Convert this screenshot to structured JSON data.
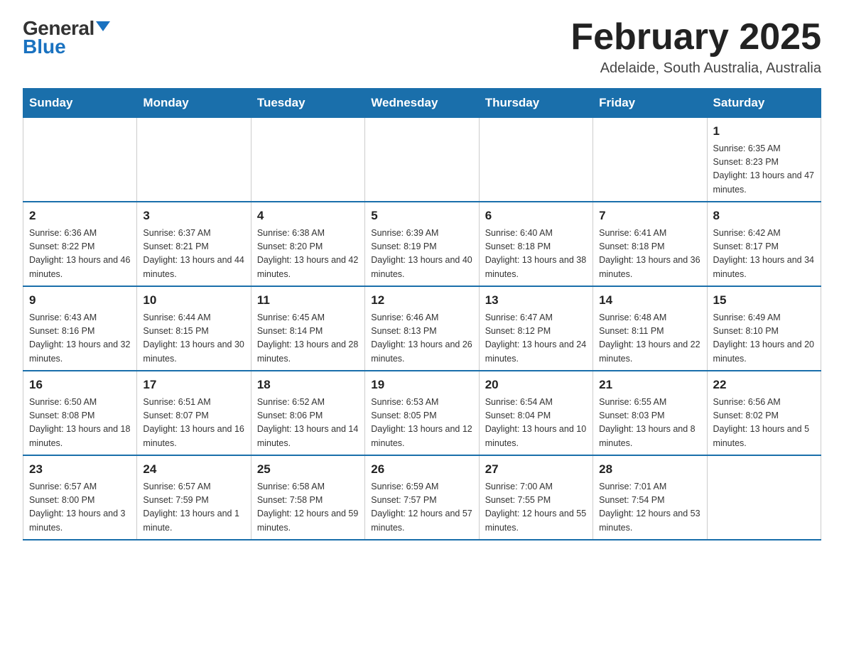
{
  "logo": {
    "general": "General",
    "blue": "Blue",
    "triangle": "▾"
  },
  "title": "February 2025",
  "subtitle": "Adelaide, South Australia, Australia",
  "headers": [
    "Sunday",
    "Monday",
    "Tuesday",
    "Wednesday",
    "Thursday",
    "Friday",
    "Saturday"
  ],
  "weeks": [
    [
      {
        "day": "",
        "info": ""
      },
      {
        "day": "",
        "info": ""
      },
      {
        "day": "",
        "info": ""
      },
      {
        "day": "",
        "info": ""
      },
      {
        "day": "",
        "info": ""
      },
      {
        "day": "",
        "info": ""
      },
      {
        "day": "1",
        "info": "Sunrise: 6:35 AM\nSunset: 8:23 PM\nDaylight: 13 hours and 47 minutes."
      }
    ],
    [
      {
        "day": "2",
        "info": "Sunrise: 6:36 AM\nSunset: 8:22 PM\nDaylight: 13 hours and 46 minutes."
      },
      {
        "day": "3",
        "info": "Sunrise: 6:37 AM\nSunset: 8:21 PM\nDaylight: 13 hours and 44 minutes."
      },
      {
        "day": "4",
        "info": "Sunrise: 6:38 AM\nSunset: 8:20 PM\nDaylight: 13 hours and 42 minutes."
      },
      {
        "day": "5",
        "info": "Sunrise: 6:39 AM\nSunset: 8:19 PM\nDaylight: 13 hours and 40 minutes."
      },
      {
        "day": "6",
        "info": "Sunrise: 6:40 AM\nSunset: 8:18 PM\nDaylight: 13 hours and 38 minutes."
      },
      {
        "day": "7",
        "info": "Sunrise: 6:41 AM\nSunset: 8:18 PM\nDaylight: 13 hours and 36 minutes."
      },
      {
        "day": "8",
        "info": "Sunrise: 6:42 AM\nSunset: 8:17 PM\nDaylight: 13 hours and 34 minutes."
      }
    ],
    [
      {
        "day": "9",
        "info": "Sunrise: 6:43 AM\nSunset: 8:16 PM\nDaylight: 13 hours and 32 minutes."
      },
      {
        "day": "10",
        "info": "Sunrise: 6:44 AM\nSunset: 8:15 PM\nDaylight: 13 hours and 30 minutes."
      },
      {
        "day": "11",
        "info": "Sunrise: 6:45 AM\nSunset: 8:14 PM\nDaylight: 13 hours and 28 minutes."
      },
      {
        "day": "12",
        "info": "Sunrise: 6:46 AM\nSunset: 8:13 PM\nDaylight: 13 hours and 26 minutes."
      },
      {
        "day": "13",
        "info": "Sunrise: 6:47 AM\nSunset: 8:12 PM\nDaylight: 13 hours and 24 minutes."
      },
      {
        "day": "14",
        "info": "Sunrise: 6:48 AM\nSunset: 8:11 PM\nDaylight: 13 hours and 22 minutes."
      },
      {
        "day": "15",
        "info": "Sunrise: 6:49 AM\nSunset: 8:10 PM\nDaylight: 13 hours and 20 minutes."
      }
    ],
    [
      {
        "day": "16",
        "info": "Sunrise: 6:50 AM\nSunset: 8:08 PM\nDaylight: 13 hours and 18 minutes."
      },
      {
        "day": "17",
        "info": "Sunrise: 6:51 AM\nSunset: 8:07 PM\nDaylight: 13 hours and 16 minutes."
      },
      {
        "day": "18",
        "info": "Sunrise: 6:52 AM\nSunset: 8:06 PM\nDaylight: 13 hours and 14 minutes."
      },
      {
        "day": "19",
        "info": "Sunrise: 6:53 AM\nSunset: 8:05 PM\nDaylight: 13 hours and 12 minutes."
      },
      {
        "day": "20",
        "info": "Sunrise: 6:54 AM\nSunset: 8:04 PM\nDaylight: 13 hours and 10 minutes."
      },
      {
        "day": "21",
        "info": "Sunrise: 6:55 AM\nSunset: 8:03 PM\nDaylight: 13 hours and 8 minutes."
      },
      {
        "day": "22",
        "info": "Sunrise: 6:56 AM\nSunset: 8:02 PM\nDaylight: 13 hours and 5 minutes."
      }
    ],
    [
      {
        "day": "23",
        "info": "Sunrise: 6:57 AM\nSunset: 8:00 PM\nDaylight: 13 hours and 3 minutes."
      },
      {
        "day": "24",
        "info": "Sunrise: 6:57 AM\nSunset: 7:59 PM\nDaylight: 13 hours and 1 minute."
      },
      {
        "day": "25",
        "info": "Sunrise: 6:58 AM\nSunset: 7:58 PM\nDaylight: 12 hours and 59 minutes."
      },
      {
        "day": "26",
        "info": "Sunrise: 6:59 AM\nSunset: 7:57 PM\nDaylight: 12 hours and 57 minutes."
      },
      {
        "day": "27",
        "info": "Sunrise: 7:00 AM\nSunset: 7:55 PM\nDaylight: 12 hours and 55 minutes."
      },
      {
        "day": "28",
        "info": "Sunrise: 7:01 AM\nSunset: 7:54 PM\nDaylight: 12 hours and 53 minutes."
      },
      {
        "day": "",
        "info": ""
      }
    ]
  ]
}
